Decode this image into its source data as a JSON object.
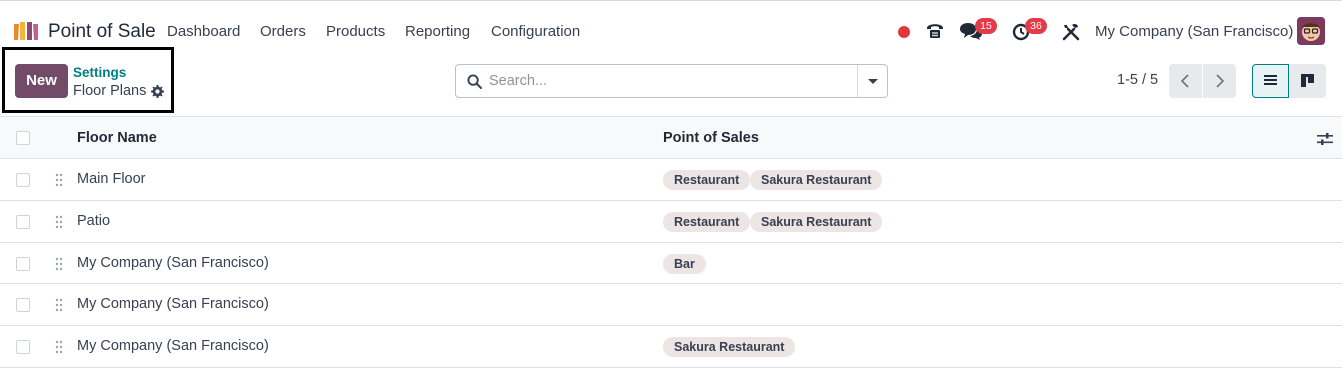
{
  "app": {
    "name": "Point of Sale"
  },
  "nav": {
    "items": [
      "Dashboard",
      "Orders",
      "Products",
      "Reporting",
      "Configuration"
    ]
  },
  "systray": {
    "messages_count": "15",
    "activities_count": "36",
    "company": "My Company (San Francisco)",
    "status_color": "#e5363b"
  },
  "control_panel": {
    "new_label": "New",
    "breadcrumb_parent": "Settings",
    "breadcrumb_current": "Floor Plans",
    "search_placeholder": "Search...",
    "pager": "1-5 / 5"
  },
  "table": {
    "columns": [
      "Floor Name",
      "Point of Sales"
    ],
    "rows": [
      {
        "name": "Main Floor",
        "pos": [
          "Restaurant",
          "Sakura Restaurant"
        ]
      },
      {
        "name": "Patio",
        "pos": [
          "Restaurant",
          "Sakura Restaurant"
        ]
      },
      {
        "name": "My Company (San Francisco)",
        "pos": [
          "Bar"
        ]
      },
      {
        "name": "My Company (San Francisco)",
        "pos": []
      },
      {
        "name": "My Company (San Francisco)",
        "pos": [
          "Sakura Restaurant"
        ]
      }
    ]
  },
  "colors": {
    "brand": "#714b67",
    "link": "#017e84",
    "tag_bg": "#ede4e4",
    "badge": "#e23b4a"
  }
}
